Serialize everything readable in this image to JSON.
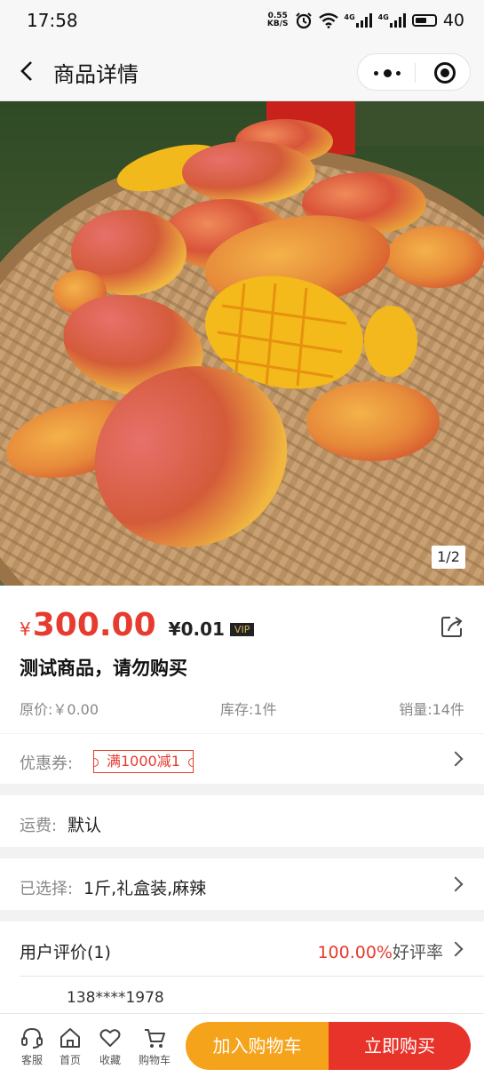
{
  "status_bar": {
    "time": "17:58",
    "net_speed_value": "0.55",
    "net_speed_unit": "KB/S",
    "network_label_1": "4G",
    "network_label_2": "4G",
    "battery": "40",
    "icons": [
      "alarm-icon",
      "wifi-icon",
      "signal-icon",
      "signal-icon",
      "battery-icon"
    ]
  },
  "nav": {
    "title": "商品详情",
    "icons": [
      "back-icon",
      "more-icon",
      "close-miniprogram-icon"
    ]
  },
  "gallery": {
    "counter": "1/2",
    "current_index": 1,
    "total": 2
  },
  "product": {
    "price_currency": "¥",
    "price": "300.00",
    "vip_price": "¥0.01",
    "vip_badge": "VIP",
    "name": "测试商品，请勿购买",
    "original_price": "原价:￥0.00",
    "stock": "库存:1件",
    "sales": "销量:14件"
  },
  "coupon": {
    "label": "优惠券:",
    "tag": "满1000减1"
  },
  "shipping": {
    "label": "运费:",
    "value": "默认"
  },
  "selection": {
    "label": "已选择:",
    "value": "1斤,礼盒装,麻辣"
  },
  "reviews": {
    "title": "用户评价(1)",
    "rate": "100.00%",
    "rate_label": "好评率",
    "first_reviewer": "138****1978"
  },
  "bottom_bar": {
    "tools": [
      {
        "label": "客服",
        "icon": "headset-icon"
      },
      {
        "label": "首页",
        "icon": "home-icon"
      },
      {
        "label": "收藏",
        "icon": "heart-icon"
      },
      {
        "label": "购物车",
        "icon": "cart-icon"
      }
    ],
    "add_to_cart": "加入购物车",
    "buy_now": "立即购买"
  },
  "colors": {
    "price_red": "#e63b2e",
    "cart_orange": "#f5a31a",
    "buy_red": "#e8332a"
  }
}
